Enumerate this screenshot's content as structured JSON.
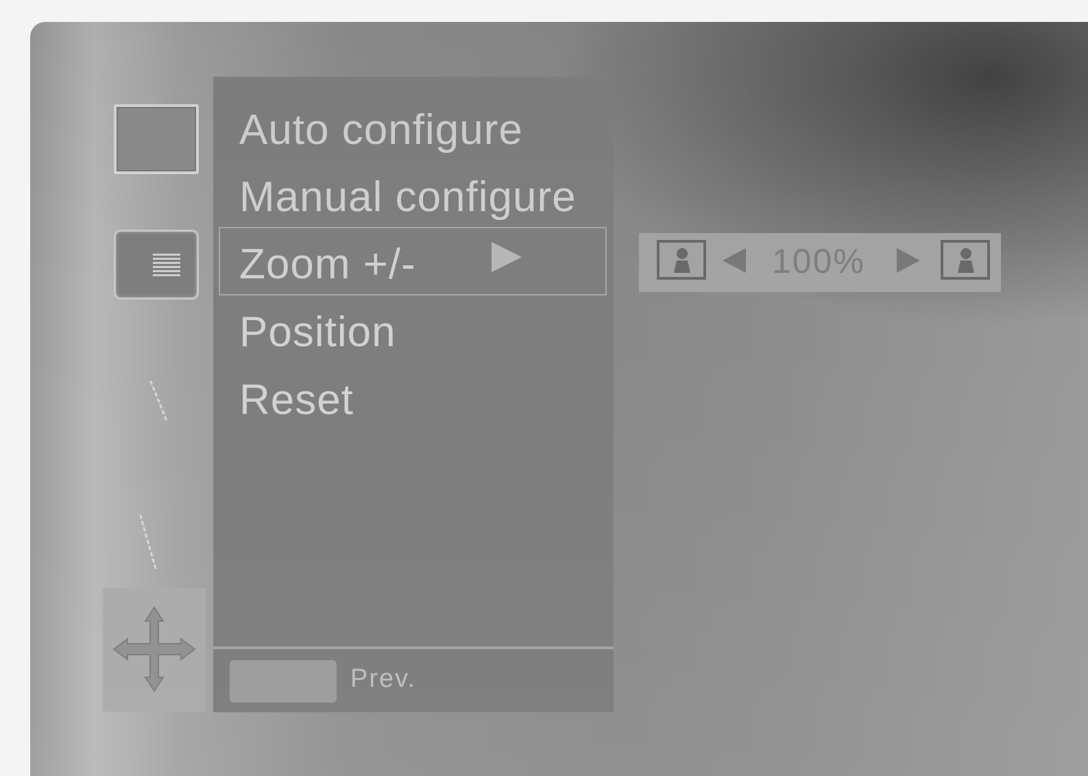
{
  "menu": {
    "items": [
      {
        "label": "Auto configure"
      },
      {
        "label": "Manual configure"
      },
      {
        "label": "Zoom +/-"
      },
      {
        "label": "Position"
      },
      {
        "label": "Reset"
      }
    ],
    "selected_index": 2,
    "footer_label": "Prev."
  },
  "zoom": {
    "value": "100%",
    "decrease_icon": "zoom-out-person-icon",
    "increase_icon": "zoom-in-person-icon"
  },
  "rail": {
    "icons": [
      "picture-icon",
      "screen-setup-icon",
      "audio-icon",
      "time-icon",
      "move-icon"
    ],
    "selected_icon": "move-icon"
  },
  "colors": {
    "menu_background": "#7d7d7d",
    "menu_text": "#d2d2d2",
    "highlight_border": "#a8a8a8",
    "zoom_bar": "#a5a5a5"
  }
}
